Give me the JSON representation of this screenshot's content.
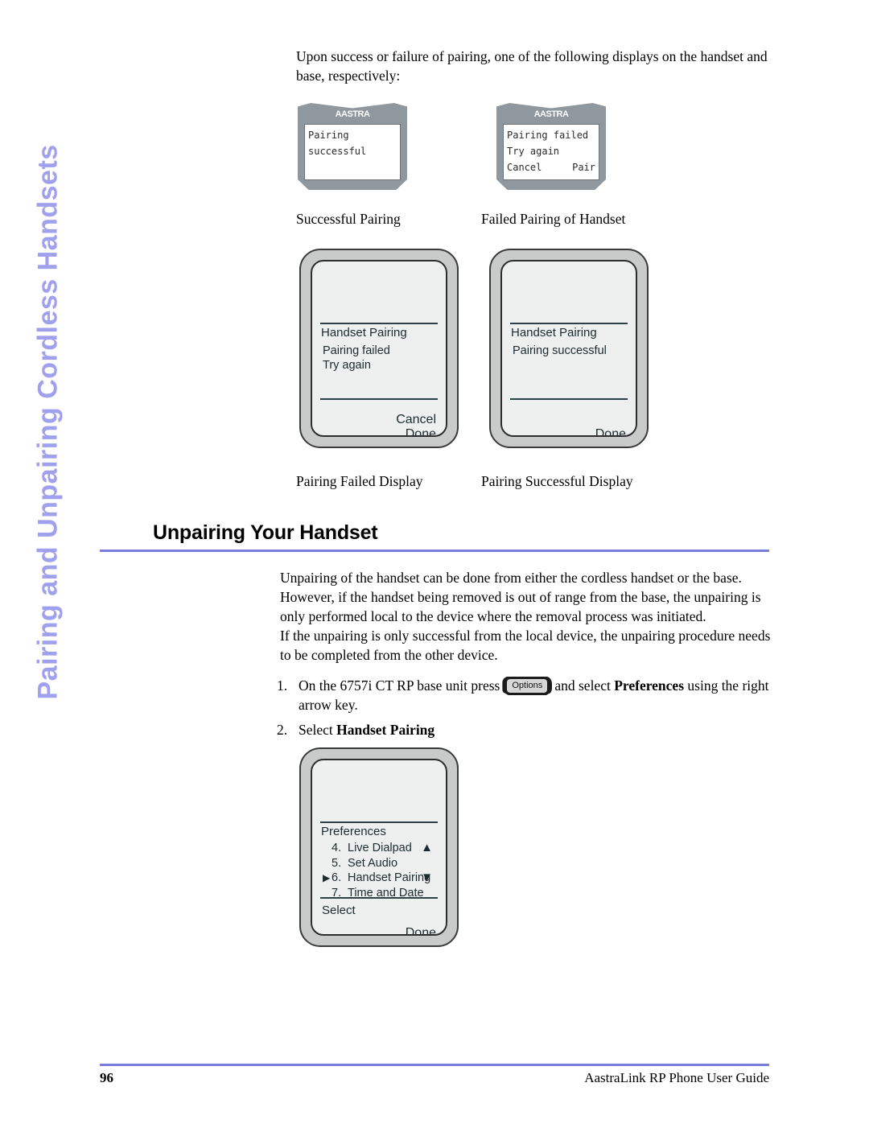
{
  "page": {
    "side_tab_text": "Pairing and Unpairing Cordless Handsets",
    "accent_color": "#7b7bdb",
    "side_tab_color": "#a0a0ee"
  },
  "intro": {
    "paragraph": "Upon success or failure of pairing, one of the following displays on the handset and base, respectively:"
  },
  "handsets": [
    {
      "logo": "AASTRA",
      "line1": "Pairing",
      "line2": "successful",
      "softkey_left": "",
      "softkey_right": "",
      "caption": "Successful Pairing"
    },
    {
      "logo": "AASTRA",
      "line1": "Pairing failed",
      "line2": "Try again",
      "softkey_left": "Cancel",
      "softkey_right": "Pair",
      "caption": "Failed Pairing of Handset"
    }
  ],
  "base_displays": [
    {
      "title": "Handset Pairing",
      "body_line1": "Pairing failed",
      "body_line2": "Try again",
      "softkey1": "Cancel",
      "softkey2": "Done",
      "caption": "Pairing Failed Display"
    },
    {
      "title": "Handset Pairing",
      "body_line1": "Pairing successful",
      "body_line2": "",
      "softkey1": "",
      "softkey2": "Done",
      "caption": "Pairing Successful Display"
    }
  ],
  "section": {
    "heading": "Unpairing Your Handset",
    "paragraph1": "Unpairing of the handset can be done from either the cordless handset or the base. However, if the handset being removed is out of range from the base, the unpairing is only performed local to the device where the removal process was initiated.",
    "paragraph2": "If the unpairing is only successful from the local device, the unpairing procedure needs to be completed from the other device."
  },
  "steps": [
    {
      "number": "1.",
      "text_before": "On the 6757i CT RP base unit press",
      "key_label": "Options",
      "text_after_1": "and select",
      "bold_term": "Preferences",
      "text_after_2": "using the right arrow key."
    },
    {
      "number": "2.",
      "text_before": "Select",
      "bold_term": "Handset Pairing"
    }
  ],
  "menu_display": {
    "title": "Preferences",
    "items": [
      {
        "marker": "",
        "number": "4.",
        "label": "Live Dialpad"
      },
      {
        "marker": "",
        "number": "5.",
        "label": "Set Audio"
      },
      {
        "marker": "▶",
        "number": "6.",
        "label": "Handset Pairing"
      },
      {
        "marker": "",
        "number": "7.",
        "label": "Time and Date"
      }
    ],
    "arrow_up": "▲",
    "arrow_down": "▼",
    "softkey_select": "Select",
    "softkey_done": "Done"
  },
  "footer": {
    "page_number": "96",
    "guide_title": "AastraLink RP Phone User Guide"
  }
}
